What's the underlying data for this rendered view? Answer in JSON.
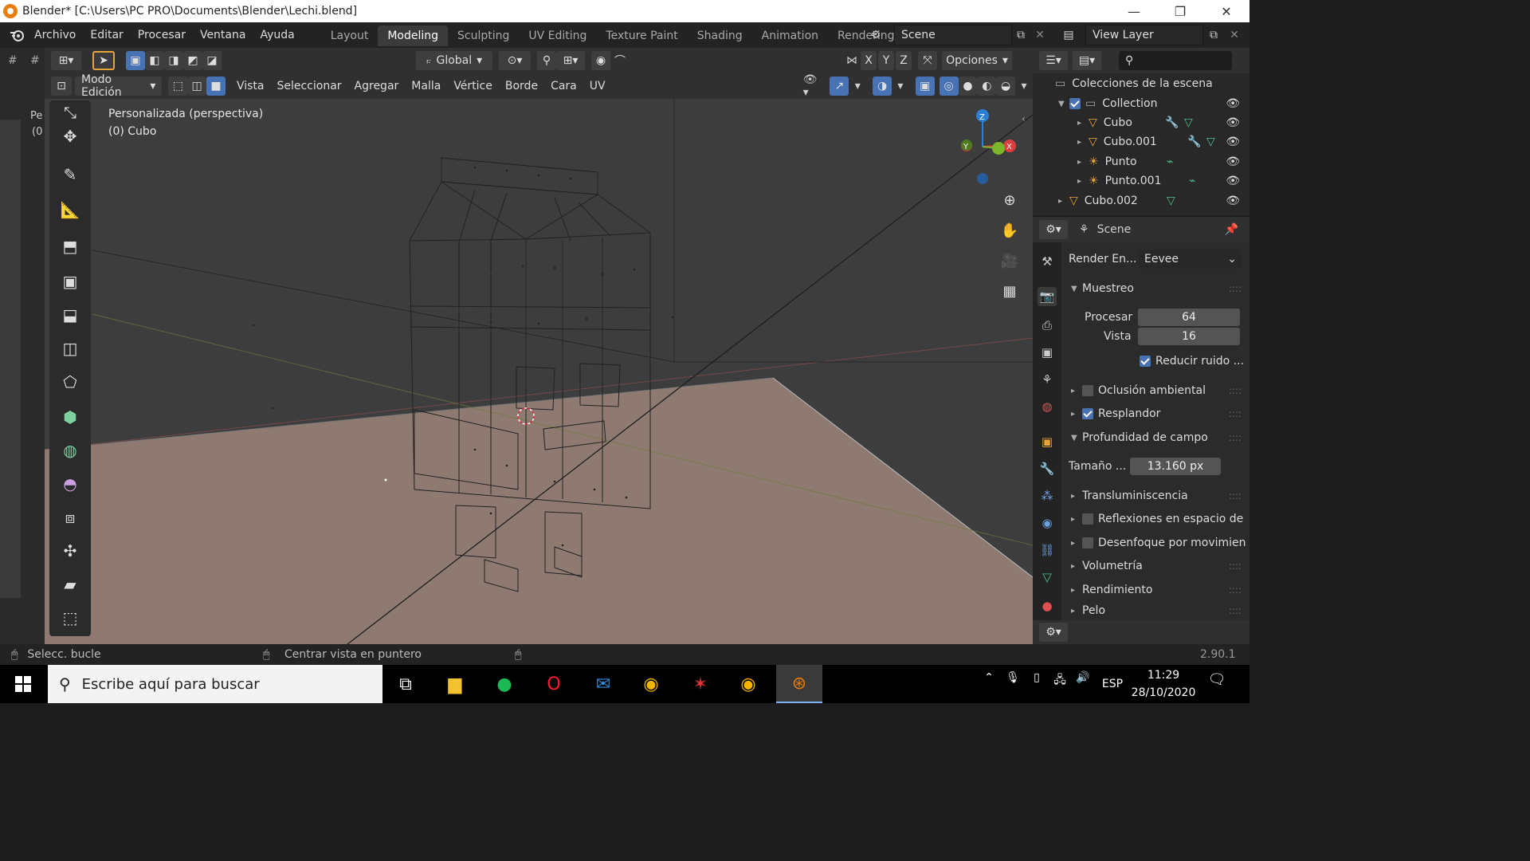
{
  "window": {
    "title": "Blender* [C:\\Users\\PC PRO\\Documents\\Blender\\Lechi.blend]",
    "minimize": "—",
    "maximize": "❐",
    "close": "✕"
  },
  "menu": [
    "Archivo",
    "Editar",
    "Procesar",
    "Ventana",
    "Ayuda"
  ],
  "workspaces": [
    "Layout",
    "Modeling",
    "Sculpting",
    "UV Editing",
    "Texture Paint",
    "Shading",
    "Animation",
    "Rendering"
  ],
  "active_workspace": "Modeling",
  "scene": {
    "name": "Scene"
  },
  "view_layer": {
    "name": "View Layer"
  },
  "tool_header": {
    "transform_orientation": "Global",
    "axes": [
      "X",
      "Y",
      "Z"
    ],
    "options": "Opciones"
  },
  "edit_header": {
    "mode": "Modo Edición",
    "menus": [
      "Vista",
      "Seleccionar",
      "Agregar",
      "Malla",
      "Vértice",
      "Borde",
      "Cara",
      "UV"
    ]
  },
  "viewport": {
    "view_name": "Personalizada (perspectiva)",
    "object_name": "(0) Cubo",
    "gizmo": {
      "x": "X",
      "y": "Y",
      "z": "Z"
    }
  },
  "left_panel": {
    "frag1": "Pe",
    "frag2": "(0"
  },
  "outliner": {
    "root": "Colecciones de la escena",
    "collection": "Collection",
    "items": [
      {
        "name": "Cubo",
        "type": "mesh"
      },
      {
        "name": "Cubo.001",
        "type": "mesh"
      },
      {
        "name": "Punto",
        "type": "light"
      },
      {
        "name": "Punto.001",
        "type": "light"
      },
      {
        "name": "Cubo.002",
        "type": "mesh"
      }
    ]
  },
  "properties": {
    "context": "Scene",
    "render_engine_label": "Render En...",
    "render_engine": "Eevee",
    "sampling": {
      "title": "Muestreo",
      "render_label": "Procesar",
      "render_value": "64",
      "viewport_label": "Vista",
      "viewport_value": "16",
      "denoise": "Reducir ruido ..."
    },
    "panels": [
      {
        "label": "Oclusión ambiental",
        "checkbox": true,
        "checked": false
      },
      {
        "label": "Resplandor",
        "checkbox": true,
        "checked": true
      },
      {
        "label": "Profundidad de campo",
        "checkbox": false,
        "expanded": true
      }
    ],
    "dof": {
      "label": "Tamaño ...",
      "value": "13.160 px"
    },
    "panels2": [
      {
        "label": "Transluminiscencia",
        "checkbox": false
      },
      {
        "label": "Reflexiones en espacio de",
        "checkbox": true
      },
      {
        "label": "Desenfoque por movimien",
        "checkbox": true
      },
      {
        "label": "Volumetría",
        "checkbox": false
      },
      {
        "label": "Rendimiento",
        "checkbox": false
      },
      {
        "label": "Pelo",
        "checkbox": false
      }
    ]
  },
  "statusbar": {
    "left": "Selecc. bucle",
    "middle": "Centrar vista en puntero",
    "version": "2.90.1"
  },
  "taskbar": {
    "search_placeholder": "Escribe aquí para buscar",
    "lang": "ESP",
    "time": "11:29",
    "date": "28/10/2020"
  },
  "colors": {
    "accent": "#4772b3",
    "active_tab": "#3b3b3b",
    "floor": "#8f7a72",
    "blender_orange": "#e87d0d"
  }
}
